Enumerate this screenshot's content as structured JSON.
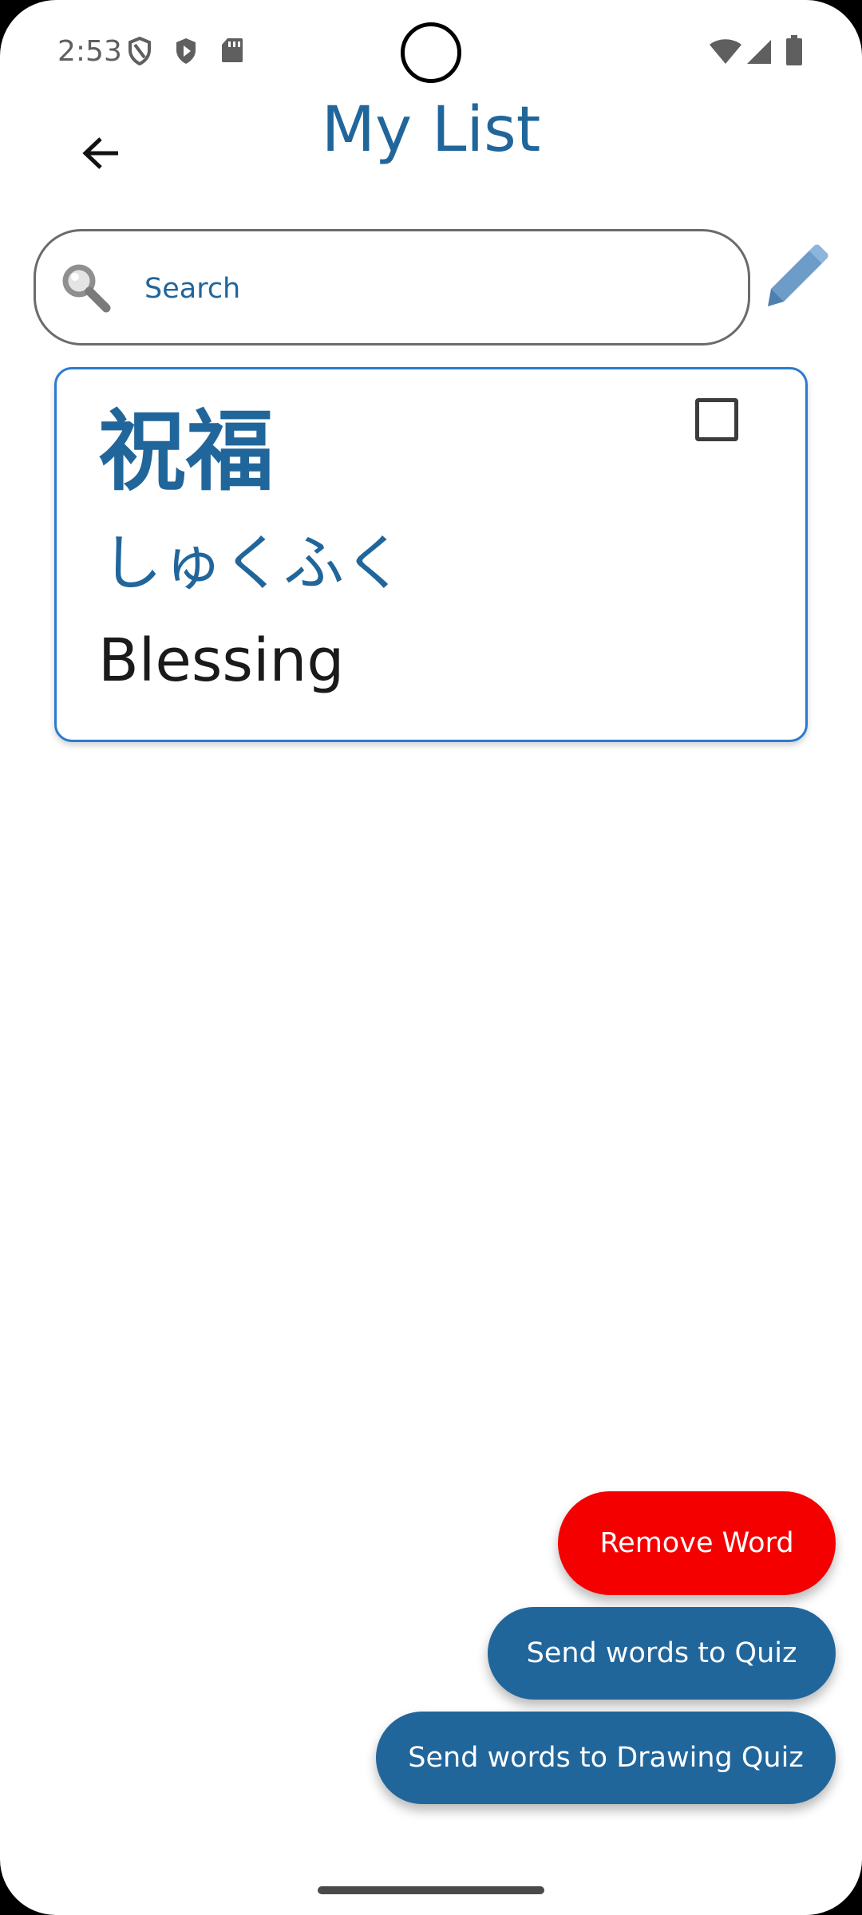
{
  "status_bar": {
    "time": "2:53",
    "left_icons": [
      "shield-outline-icon",
      "play-protect-icon",
      "sd-card-icon"
    ],
    "right_icons": [
      "wifi-icon",
      "cellular-signal-icon",
      "battery-icon"
    ]
  },
  "header": {
    "title": "My List",
    "back_icon": "arrow-left-icon"
  },
  "search": {
    "placeholder": "Search",
    "value": "",
    "icon": "magnifier-icon"
  },
  "edit_icon": "pencil-icon",
  "words": [
    {
      "kanji": "祝福",
      "reading": "しゅくふく",
      "meaning": "Blessing",
      "checked": false
    }
  ],
  "actions": {
    "remove_label": "Remove Word",
    "quiz_label": "Send words to Quiz",
    "drawing_quiz_label": "Send words to Drawing Quiz"
  },
  "colors": {
    "primary": "#21669b",
    "danger": "#f40000",
    "card_border": "#2a7bd0",
    "background": "#ffffff"
  }
}
